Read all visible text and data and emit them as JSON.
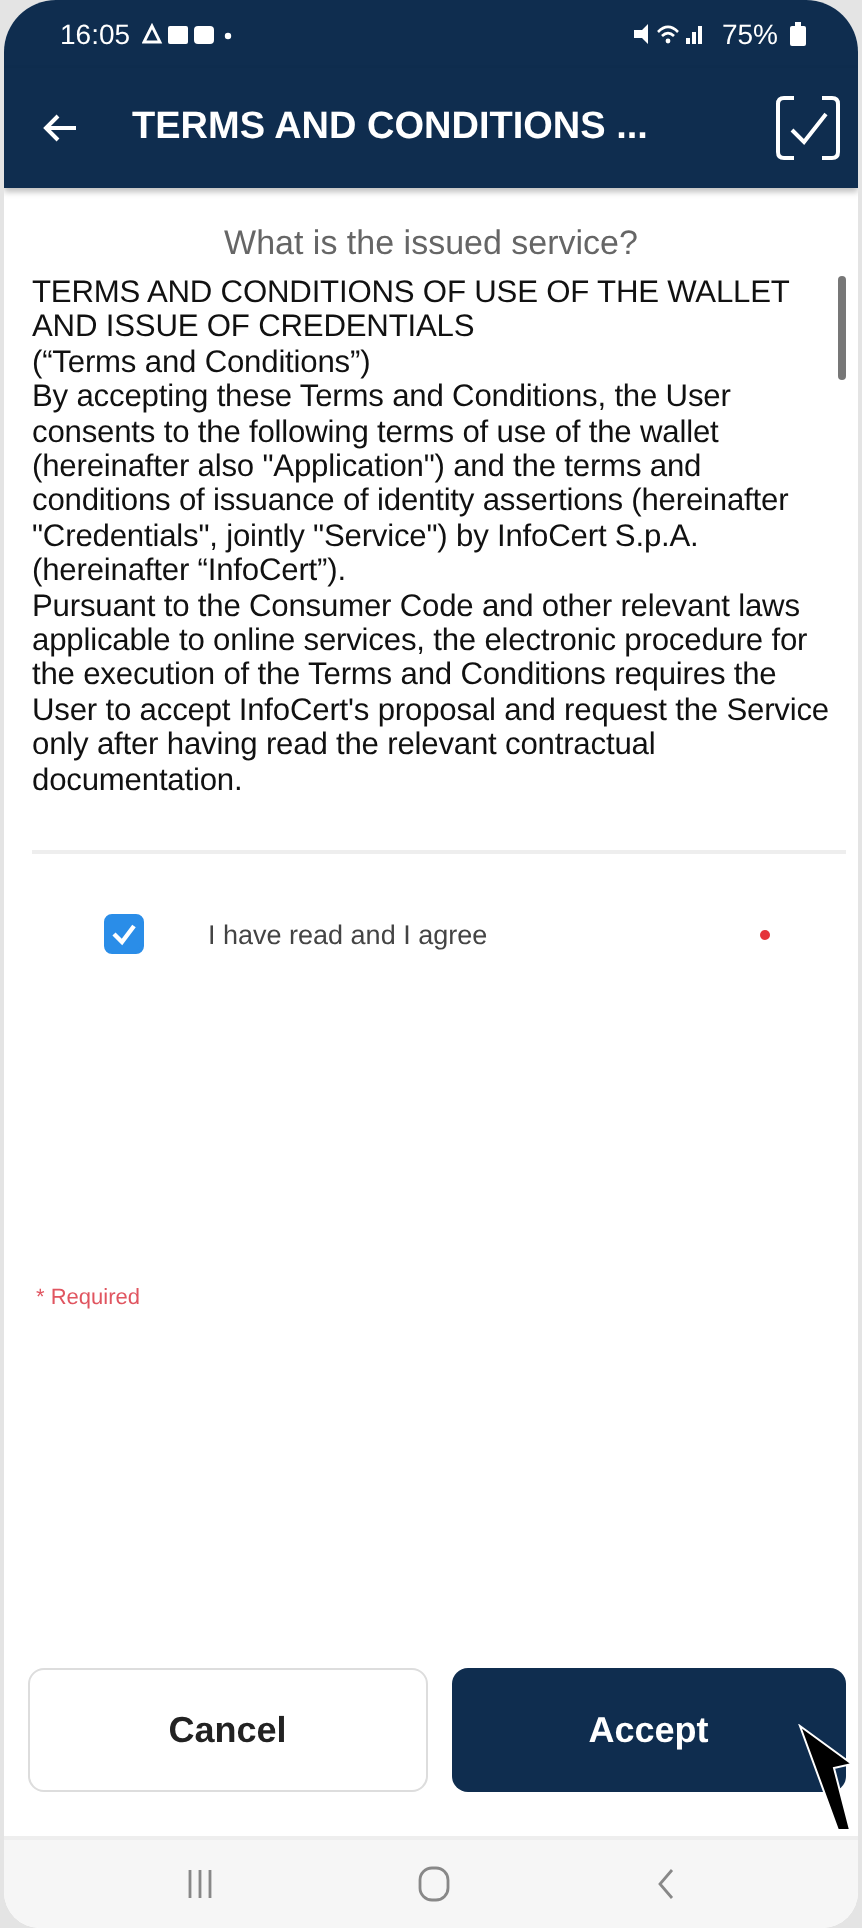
{
  "status_bar": {
    "time": "16:05",
    "battery": "75%"
  },
  "app_bar": {
    "title": "TERMS AND CONDITIONS ..."
  },
  "question": "What is the issued service?",
  "terms": [
    "TERMS AND CONDITIONS OF USE OF THE WALLET AND ISSUE OF CREDENTIALS",
    "(“Terms and Conditions”)",
    "By accepting these Terms and Conditions, the User consents to the following terms of use of the wallet (hereinafter also \"Application\") and the terms and conditions of issuance of identity assertions (hereinafter \"Credentials\", jointly \"Service\") by InfoCert S.p.A. (hereinafter “InfoCert”).",
    "Pursuant to the Consumer Code and other relevant laws applicable to online services, the electronic procedure for the execution of the Terms and Conditions requires the User to accept InfoCert's proposal and request the Service only after having read the relevant contractual documentation."
  ],
  "agreement": {
    "label": "I have read and I agree",
    "checked": true,
    "required": true
  },
  "required_note": "* Required",
  "buttons": [
    {
      "label": "Cancel",
      "kind": "secondary"
    },
    {
      "label": "Accept",
      "kind": "primary"
    }
  ]
}
